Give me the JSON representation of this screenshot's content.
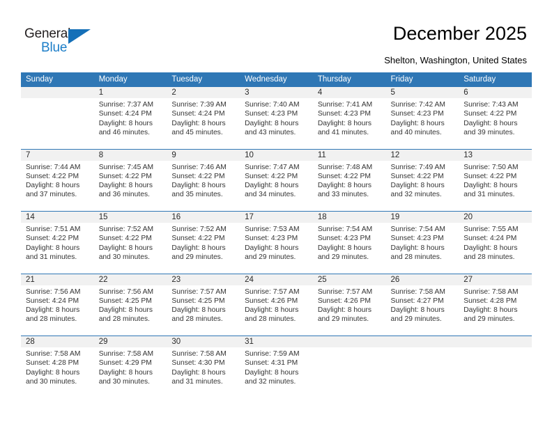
{
  "brand": {
    "name_part1": "General",
    "name_part2": "Blue",
    "triangle_color": "#1570b8",
    "blue_text_color": "#1c7ec8"
  },
  "header": {
    "title": "December 2025",
    "location": "Shelton, Washington, United States",
    "accent_color": "#2f77b5",
    "daynum_bg": "#f1f1f1"
  },
  "weekdays": [
    "Sunday",
    "Monday",
    "Tuesday",
    "Wednesday",
    "Thursday",
    "Friday",
    "Saturday"
  ],
  "labels": {
    "sunrise_prefix": "Sunrise:",
    "sunset_prefix": "Sunset:",
    "daylight_prefix": "Daylight:"
  },
  "weeks": [
    [
      {
        "day": "",
        "l1": "",
        "l2": "",
        "l3": "",
        "l4": ""
      },
      {
        "day": "1",
        "l1": "Sunrise: 7:37 AM",
        "l2": "Sunset: 4:24 PM",
        "l3": "Daylight: 8 hours",
        "l4": "and 46 minutes."
      },
      {
        "day": "2",
        "l1": "Sunrise: 7:39 AM",
        "l2": "Sunset: 4:24 PM",
        "l3": "Daylight: 8 hours",
        "l4": "and 45 minutes."
      },
      {
        "day": "3",
        "l1": "Sunrise: 7:40 AM",
        "l2": "Sunset: 4:23 PM",
        "l3": "Daylight: 8 hours",
        "l4": "and 43 minutes."
      },
      {
        "day": "4",
        "l1": "Sunrise: 7:41 AM",
        "l2": "Sunset: 4:23 PM",
        "l3": "Daylight: 8 hours",
        "l4": "and 41 minutes."
      },
      {
        "day": "5",
        "l1": "Sunrise: 7:42 AM",
        "l2": "Sunset: 4:23 PM",
        "l3": "Daylight: 8 hours",
        "l4": "and 40 minutes."
      },
      {
        "day": "6",
        "l1": "Sunrise: 7:43 AM",
        "l2": "Sunset: 4:22 PM",
        "l3": "Daylight: 8 hours",
        "l4": "and 39 minutes."
      }
    ],
    [
      {
        "day": "7",
        "l1": "Sunrise: 7:44 AM",
        "l2": "Sunset: 4:22 PM",
        "l3": "Daylight: 8 hours",
        "l4": "and 37 minutes."
      },
      {
        "day": "8",
        "l1": "Sunrise: 7:45 AM",
        "l2": "Sunset: 4:22 PM",
        "l3": "Daylight: 8 hours",
        "l4": "and 36 minutes."
      },
      {
        "day": "9",
        "l1": "Sunrise: 7:46 AM",
        "l2": "Sunset: 4:22 PM",
        "l3": "Daylight: 8 hours",
        "l4": "and 35 minutes."
      },
      {
        "day": "10",
        "l1": "Sunrise: 7:47 AM",
        "l2": "Sunset: 4:22 PM",
        "l3": "Daylight: 8 hours",
        "l4": "and 34 minutes."
      },
      {
        "day": "11",
        "l1": "Sunrise: 7:48 AM",
        "l2": "Sunset: 4:22 PM",
        "l3": "Daylight: 8 hours",
        "l4": "and 33 minutes."
      },
      {
        "day": "12",
        "l1": "Sunrise: 7:49 AM",
        "l2": "Sunset: 4:22 PM",
        "l3": "Daylight: 8 hours",
        "l4": "and 32 minutes."
      },
      {
        "day": "13",
        "l1": "Sunrise: 7:50 AM",
        "l2": "Sunset: 4:22 PM",
        "l3": "Daylight: 8 hours",
        "l4": "and 31 minutes."
      }
    ],
    [
      {
        "day": "14",
        "l1": "Sunrise: 7:51 AM",
        "l2": "Sunset: 4:22 PM",
        "l3": "Daylight: 8 hours",
        "l4": "and 31 minutes."
      },
      {
        "day": "15",
        "l1": "Sunrise: 7:52 AM",
        "l2": "Sunset: 4:22 PM",
        "l3": "Daylight: 8 hours",
        "l4": "and 30 minutes."
      },
      {
        "day": "16",
        "l1": "Sunrise: 7:52 AM",
        "l2": "Sunset: 4:22 PM",
        "l3": "Daylight: 8 hours",
        "l4": "and 29 minutes."
      },
      {
        "day": "17",
        "l1": "Sunrise: 7:53 AM",
        "l2": "Sunset: 4:23 PM",
        "l3": "Daylight: 8 hours",
        "l4": "and 29 minutes."
      },
      {
        "day": "18",
        "l1": "Sunrise: 7:54 AM",
        "l2": "Sunset: 4:23 PM",
        "l3": "Daylight: 8 hours",
        "l4": "and 29 minutes."
      },
      {
        "day": "19",
        "l1": "Sunrise: 7:54 AM",
        "l2": "Sunset: 4:23 PM",
        "l3": "Daylight: 8 hours",
        "l4": "and 28 minutes."
      },
      {
        "day": "20",
        "l1": "Sunrise: 7:55 AM",
        "l2": "Sunset: 4:24 PM",
        "l3": "Daylight: 8 hours",
        "l4": "and 28 minutes."
      }
    ],
    [
      {
        "day": "21",
        "l1": "Sunrise: 7:56 AM",
        "l2": "Sunset: 4:24 PM",
        "l3": "Daylight: 8 hours",
        "l4": "and 28 minutes."
      },
      {
        "day": "22",
        "l1": "Sunrise: 7:56 AM",
        "l2": "Sunset: 4:25 PM",
        "l3": "Daylight: 8 hours",
        "l4": "and 28 minutes."
      },
      {
        "day": "23",
        "l1": "Sunrise: 7:57 AM",
        "l2": "Sunset: 4:25 PM",
        "l3": "Daylight: 8 hours",
        "l4": "and 28 minutes."
      },
      {
        "day": "24",
        "l1": "Sunrise: 7:57 AM",
        "l2": "Sunset: 4:26 PM",
        "l3": "Daylight: 8 hours",
        "l4": "and 28 minutes."
      },
      {
        "day": "25",
        "l1": "Sunrise: 7:57 AM",
        "l2": "Sunset: 4:26 PM",
        "l3": "Daylight: 8 hours",
        "l4": "and 29 minutes."
      },
      {
        "day": "26",
        "l1": "Sunrise: 7:58 AM",
        "l2": "Sunset: 4:27 PM",
        "l3": "Daylight: 8 hours",
        "l4": "and 29 minutes."
      },
      {
        "day": "27",
        "l1": "Sunrise: 7:58 AM",
        "l2": "Sunset: 4:28 PM",
        "l3": "Daylight: 8 hours",
        "l4": "and 29 minutes."
      }
    ],
    [
      {
        "day": "28",
        "l1": "Sunrise: 7:58 AM",
        "l2": "Sunset: 4:28 PM",
        "l3": "Daylight: 8 hours",
        "l4": "and 30 minutes."
      },
      {
        "day": "29",
        "l1": "Sunrise: 7:58 AM",
        "l2": "Sunset: 4:29 PM",
        "l3": "Daylight: 8 hours",
        "l4": "and 30 minutes."
      },
      {
        "day": "30",
        "l1": "Sunrise: 7:58 AM",
        "l2": "Sunset: 4:30 PM",
        "l3": "Daylight: 8 hours",
        "l4": "and 31 minutes."
      },
      {
        "day": "31",
        "l1": "Sunrise: 7:59 AM",
        "l2": "Sunset: 4:31 PM",
        "l3": "Daylight: 8 hours",
        "l4": "and 32 minutes."
      },
      {
        "day": "",
        "l1": "",
        "l2": "",
        "l3": "",
        "l4": ""
      },
      {
        "day": "",
        "l1": "",
        "l2": "",
        "l3": "",
        "l4": ""
      },
      {
        "day": "",
        "l1": "",
        "l2": "",
        "l3": "",
        "l4": ""
      }
    ]
  ]
}
